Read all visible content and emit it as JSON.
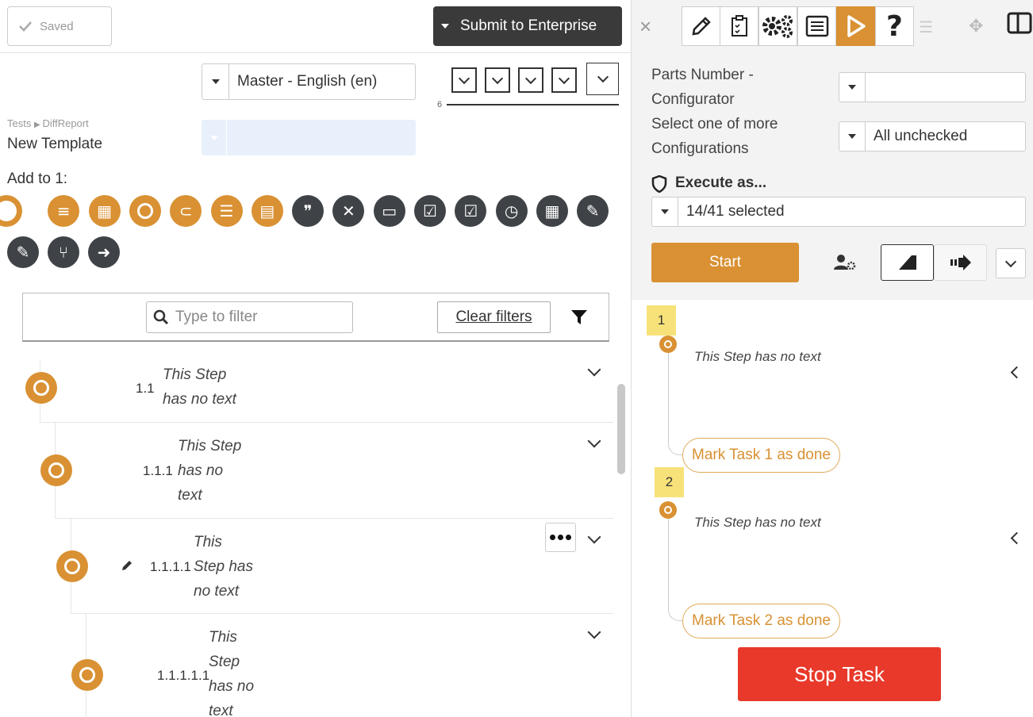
{
  "header": {
    "saved_label": "Saved",
    "submit_label": "Submit to Enterprise"
  },
  "language": {
    "selected": "Master - English (en)"
  },
  "version_marker": "6",
  "breadcrumb": {
    "root": "Tests",
    "child": "DiffReport"
  },
  "template_name": "New Template",
  "add_to_label": "Add to 1:",
  "add_icons": {
    "row1": [
      {
        "name": "loop-icon",
        "color": "#d99133"
      },
      {
        "name": "numbered-list-icon",
        "color": "#d99133"
      },
      {
        "name": "table-icon",
        "color": "#d99133"
      },
      {
        "name": "circle-step-icon",
        "color": "#d99133"
      },
      {
        "name": "attachment-icon",
        "color": "#d99133"
      },
      {
        "name": "checklist-icon",
        "color": "#d99133"
      },
      {
        "name": "film-icon",
        "color": "#d99133"
      },
      {
        "name": "quote-icon",
        "color": "#3f4347"
      },
      {
        "name": "check-x-icon",
        "color": "#3f4347"
      },
      {
        "name": "input-field-icon",
        "color": "#3f4347"
      },
      {
        "name": "check-list-icon",
        "color": "#3f4347"
      },
      {
        "name": "checkbox-icon",
        "color": "#3f4347"
      },
      {
        "name": "clock-icon",
        "color": "#3f4347"
      },
      {
        "name": "calculator-icon",
        "color": "#3f4347"
      },
      {
        "name": "tools-icon",
        "color": "#3f4347"
      }
    ],
    "row2": [
      {
        "name": "edit-note-icon",
        "color": "#3f4347"
      },
      {
        "name": "branch-icon",
        "color": "#3f4347"
      },
      {
        "name": "arrow-right-icon",
        "color": "#3f4347"
      }
    ]
  },
  "filter": {
    "placeholder": "Type to filter",
    "clear_label": "Clear filters"
  },
  "steps": [
    {
      "number": "1.1",
      "text_lines": [
        "This Step",
        "has no text"
      ]
    },
    {
      "number": "1.1.1",
      "text_lines": [
        "This Step",
        "has no",
        "text"
      ]
    },
    {
      "number": "1.1.1.1",
      "text_lines": [
        "This",
        "Step has",
        "no text"
      ]
    },
    {
      "number": "1.1.1.1.1",
      "text_lines": [
        "This",
        "Step",
        "has no",
        "text"
      ]
    }
  ],
  "right_panel": {
    "toolbar": [
      "pencil-icon",
      "clipboard-icon",
      "gears-icon",
      "checklist-board-icon",
      "play-icon",
      "help-icon"
    ],
    "parts_label_lines": [
      "Parts Number -",
      "Configurator"
    ],
    "parts_value": "",
    "config_label_lines": [
      "Select one of more",
      "Configurations"
    ],
    "config_value": "All unchecked",
    "execute_label": "Execute as...",
    "execute_value": "14/41 selected",
    "start_label": "Start",
    "tasks": [
      {
        "badge": "1",
        "step_text": "This Step has no text",
        "mark_label": "Mark Task 1 as done"
      },
      {
        "badge": "2",
        "step_text": "This Step has no text",
        "mark_label": "Mark Task 2 as done"
      }
    ],
    "stop_label": "Stop Task"
  },
  "colors": {
    "accent": "#d99133",
    "dark": "#3f4347",
    "stop": "#e8392a",
    "badge": "#f7e27a"
  }
}
